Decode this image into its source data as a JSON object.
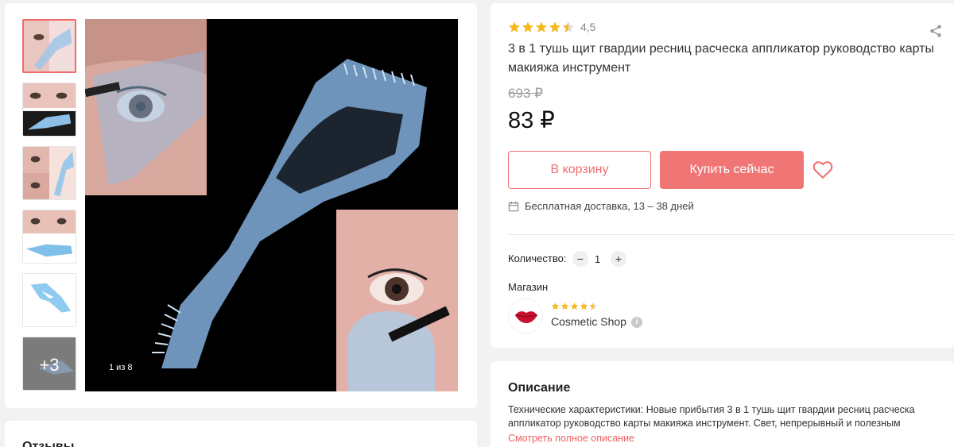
{
  "gallery": {
    "thumbnails": [
      {
        "icon": "mascara-shield-thumb-1"
      },
      {
        "icon": "mascara-shield-thumb-2"
      },
      {
        "icon": "mascara-shield-thumb-3"
      },
      {
        "icon": "mascara-shield-thumb-4"
      },
      {
        "icon": "mascara-shield-thumb-5"
      }
    ],
    "more_label": "+3",
    "counter": "1 из 8"
  },
  "reviews": {
    "title": "Отзывы"
  },
  "product": {
    "rating": "4,5",
    "rating_stars": 4.5,
    "title": "3 в 1 тушь щит гвардии ресниц расческа аппликатор руководство карты макияжа инструмент",
    "old_price": "693 ₽",
    "price": "83 ₽",
    "cart_label": "В корзину",
    "buy_label": "Купить сейчас",
    "delivery": "Бесплатная доставка, 13 – 38 дней"
  },
  "quantity": {
    "label": "Количество:",
    "minus": "−",
    "value": "1",
    "plus": "+"
  },
  "shop": {
    "label": "Магазин",
    "name": "Cosmetic Shop",
    "rating_stars": 4.5,
    "info": "i"
  },
  "description": {
    "title": "Описание",
    "text": "Технические характеристики: Новые прибытия 3 в 1 тушь щит гвардии ресниц расческа аппликатор руководство карты макияжа инструмент. Свет, непрерывный и полезным",
    "link": "Смотреть полное описание"
  },
  "colors": {
    "accent": "#f07575",
    "star": "#f5b91e"
  }
}
